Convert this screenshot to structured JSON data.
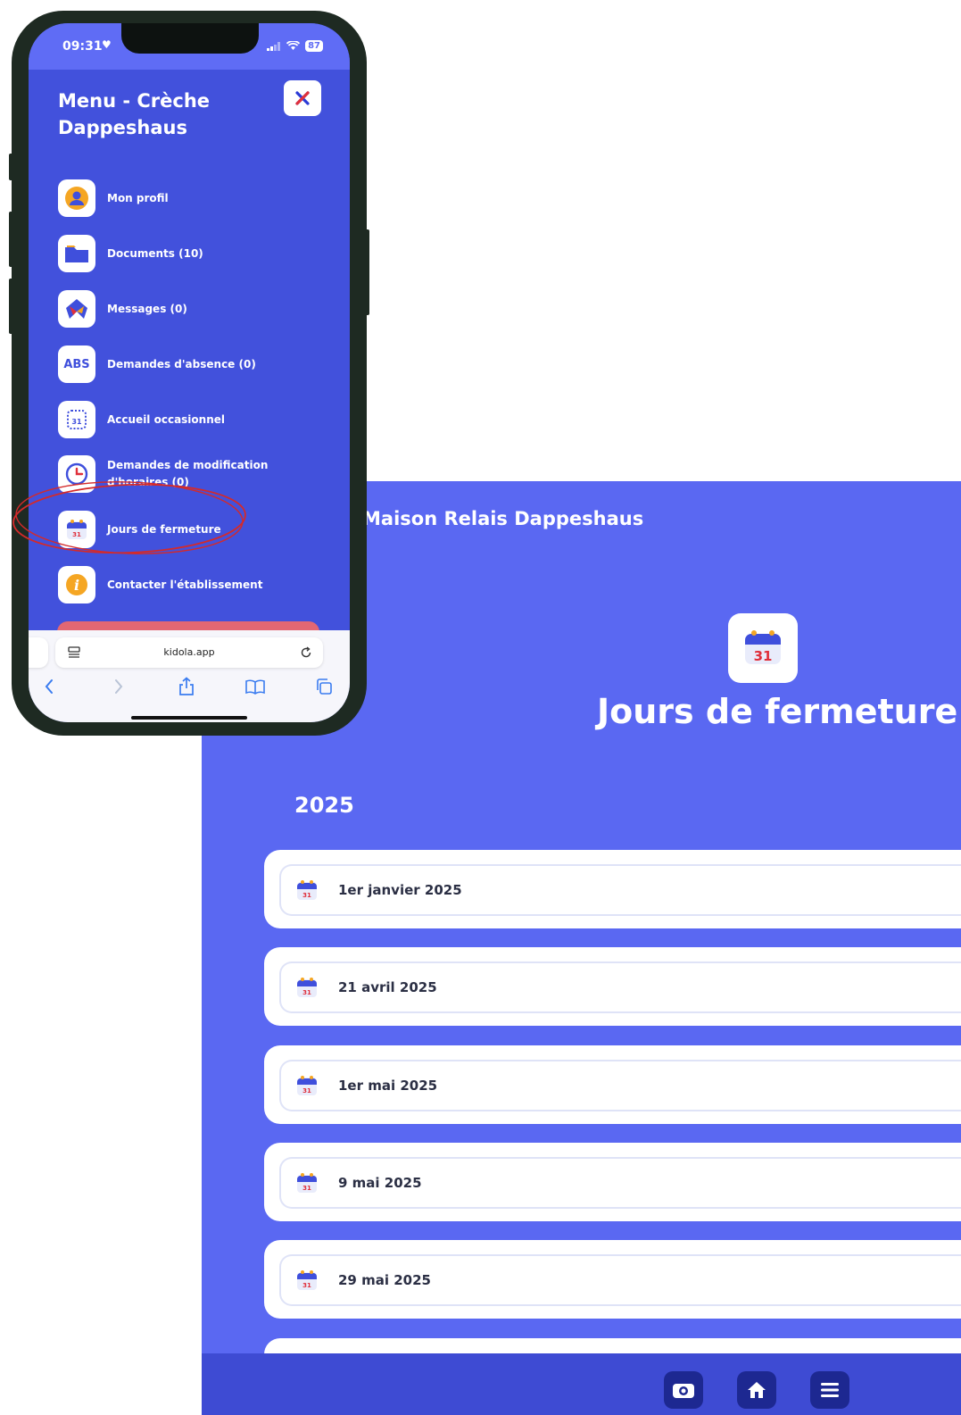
{
  "page": {
    "header_text": "Maison Relais Dappeshaus",
    "heading": "Jours de fermeture",
    "calendar_day": "31",
    "year": "2025",
    "closures": [
      {
        "label": "1er janvier 2025"
      },
      {
        "label": "21 avril 2025"
      },
      {
        "label": "1er mai 2025"
      },
      {
        "label": "9 mai 2025"
      },
      {
        "label": "29 mai 2025"
      }
    ],
    "bottom_bar": [
      "wallet-icon",
      "home-icon",
      "menu-icon"
    ]
  },
  "phone": {
    "status": {
      "time": "09:31",
      "battery": "87"
    },
    "menu_title": "Menu - Crèche Dappeshaus",
    "menu_items": [
      {
        "label": "Mon profil",
        "icon": "profile-icon"
      },
      {
        "label": "Documents (10)",
        "icon": "folder-icon"
      },
      {
        "label": "Messages (0)",
        "icon": "messages-icon"
      },
      {
        "label": "Demandes d'absence (0)",
        "icon": "abs-icon",
        "badge": "ABS"
      },
      {
        "label": "Accueil occasionnel",
        "icon": "calendar-dotted-icon"
      },
      {
        "label": "Demandes de modification d'horaires (0)",
        "icon": "clock-icon"
      },
      {
        "label": "Jours de fermeture",
        "icon": "calendar-icon"
      },
      {
        "label": "Contacter l'établissement",
        "icon": "info-icon",
        "glyph": "i"
      }
    ],
    "browser": {
      "url": "kidola.app"
    }
  },
  "colors": {
    "panel_bg": "#5a68f2",
    "menu_bg": "#4251dc",
    "bottom_bar": "#3e4bd3",
    "highlight_circle": "#d42a2a"
  }
}
